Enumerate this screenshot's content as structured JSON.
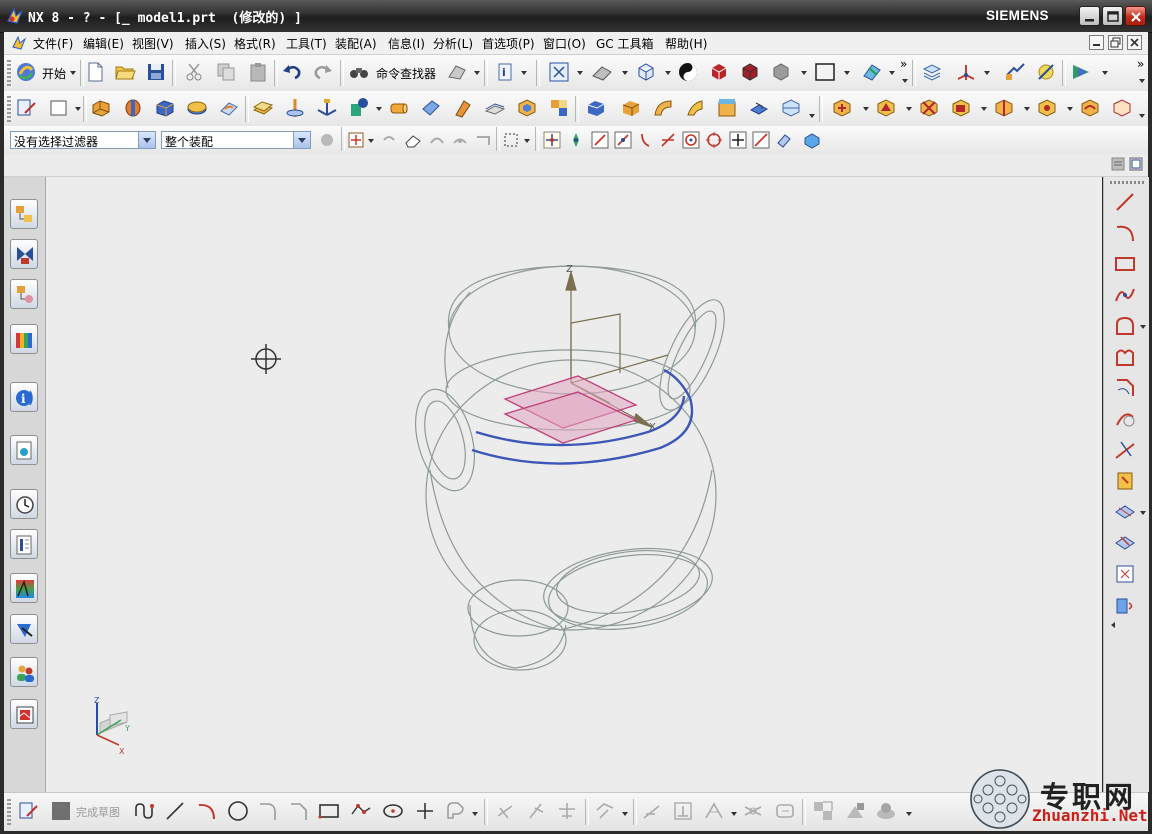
{
  "window": {
    "title": "NX 8 - ? - [_ model1.prt  (修改的) ]",
    "brand": "SIEMENS",
    "controls": [
      "minimize",
      "maximize",
      "close"
    ]
  },
  "menubar": {
    "items": [
      "文件(F)",
      "编辑(E)",
      "视图(V)",
      "插入(S)",
      "格式(R)",
      "工具(T)",
      "装配(A)",
      "信息(I)",
      "分析(L)",
      "首选项(P)",
      "窗口(O)",
      "GC 工具箱",
      "帮助(H)"
    ]
  },
  "toolbar_standard": {
    "start_label": "开始",
    "command_finder_label": "命令查找器"
  },
  "selection_bar": {
    "type_filter": "没有选择过滤器",
    "scope": "整个装配"
  },
  "sketch_bar": {
    "finish_sketch_label": "完成草图"
  },
  "left_resource_bar": {
    "icons": [
      "assembly-navigator-icon",
      "constraint-navigator-icon",
      "part-navigator-icon",
      "reuse-library-icon",
      "hd3d-tools-icon",
      "web-browser-icon",
      "history-icon",
      "system-materials-icon",
      "process-studio-icon",
      "manufacturing-wizard-icon",
      "roles-icon",
      "system-scenes-icon"
    ]
  },
  "right_sketch_bar": {
    "icons": [
      "line-icon",
      "arc-icon",
      "rectangle-icon",
      "studio-spline-icon",
      "polygon-icon",
      "fillet-icon",
      "chamfer-icon",
      "offset-curve-icon",
      "trim-icon",
      "extend-icon",
      "mirror-icon",
      "project-curve-icon",
      "intersection-curve-icon",
      "derived-line-icon"
    ]
  },
  "triad": {
    "x": "X",
    "y": "Y",
    "z": "Z"
  },
  "colors": {
    "graphics_bg": "#ececec",
    "model_edges": "#8d9a98",
    "selected_curve": "#3d57b8",
    "datum_plane": "#c0407a",
    "title_bar": "#2e2e2e"
  },
  "watermark": {
    "cn": "专职网",
    "en": "Zhuanzhi.Net"
  }
}
